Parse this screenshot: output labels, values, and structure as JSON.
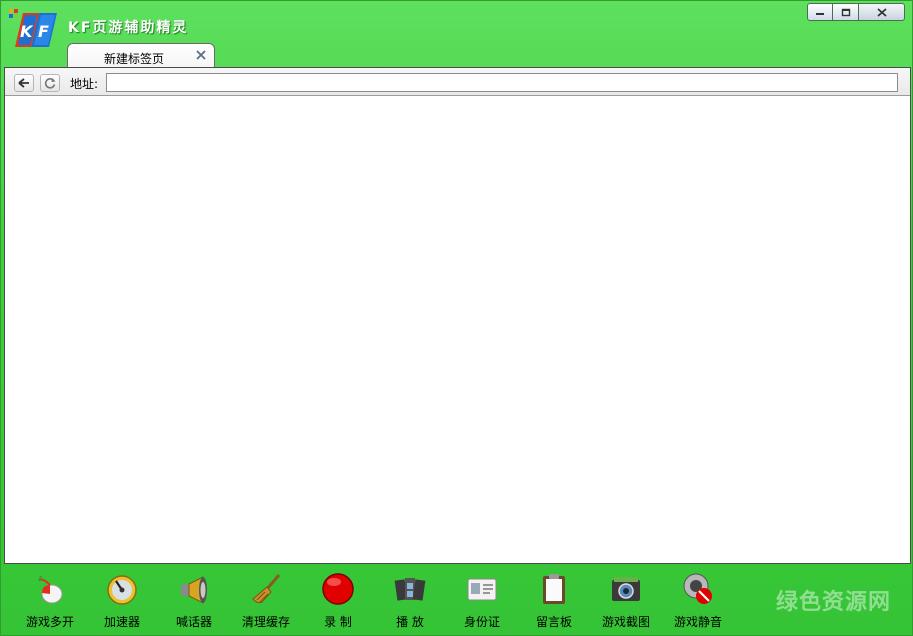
{
  "window": {
    "title": "KF页游辅助精灵",
    "controls": {
      "minimize": "minimize",
      "maximize": "maximize",
      "close": "close"
    }
  },
  "tabs": [
    {
      "label": "新建标签页",
      "active": true
    }
  ],
  "addressbar": {
    "label": "地址:",
    "value": ""
  },
  "toolbar": {
    "items": [
      {
        "label": "游戏多开",
        "icon": "mouse-icon"
      },
      {
        "label": "加速器",
        "icon": "speedometer-icon"
      },
      {
        "label": "喊话器",
        "icon": "megaphone-icon"
      },
      {
        "label": "清理缓存",
        "icon": "broom-icon"
      },
      {
        "label": "录 制",
        "icon": "record-icon"
      },
      {
        "label": "播 放",
        "icon": "film-icon"
      },
      {
        "label": "身份证",
        "icon": "id-card-icon"
      },
      {
        "label": "留言板",
        "icon": "clipboard-icon"
      },
      {
        "label": "游戏截图",
        "icon": "camera-icon"
      },
      {
        "label": "游戏静音",
        "icon": "mute-speaker-icon"
      }
    ]
  },
  "watermark": "绿色资源网",
  "colors": {
    "window_green": "#3fce3f",
    "record_red": "#e00000"
  }
}
